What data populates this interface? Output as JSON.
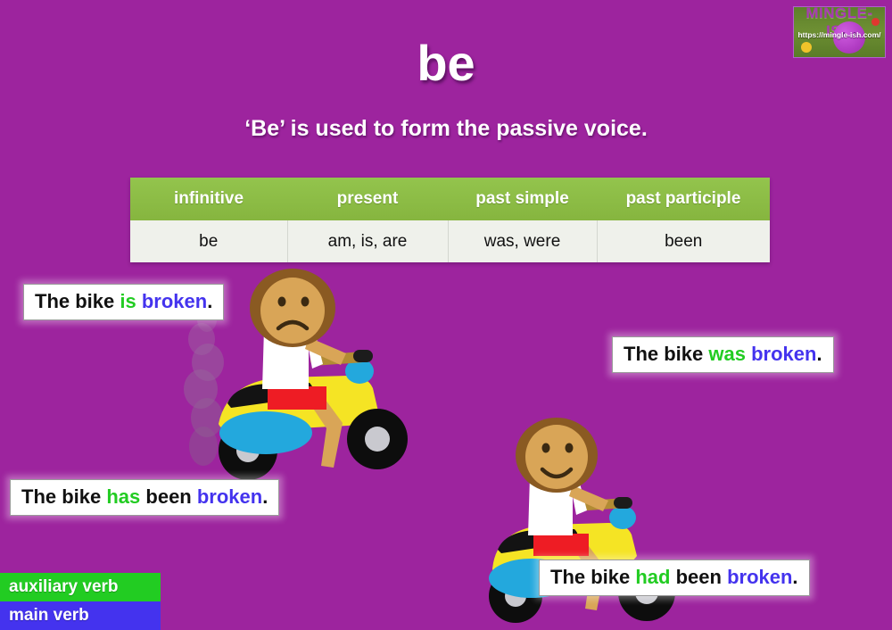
{
  "slide": {
    "title": "be",
    "subtitle": "‘Be’ is used to form the passive voice.",
    "background_color": "#9d249e",
    "background_color_light": "#ad4ec4"
  },
  "watermark": {
    "brand": "MINGLE-ISH",
    "url": "https://mingle-ish.com/",
    "background_color": "#6d8f33",
    "brand_color": "#a838b4"
  },
  "table": {
    "headers": [
      "infinitive",
      "present",
      "past simple",
      "past participle"
    ],
    "row": [
      "be",
      "am, is, are",
      "was, were",
      "been"
    ],
    "header_color": "#8cbc45",
    "row_color": "#eff1eb"
  },
  "captions": [
    {
      "id": "caption-is",
      "parts": [
        {
          "text": "The bike ",
          "role": "plain"
        },
        {
          "text": "is",
          "role": "auxiliary"
        },
        {
          "text": " ",
          "role": "plain"
        },
        {
          "text": "broken",
          "role": "main"
        },
        {
          "text": ".",
          "role": "plain"
        }
      ]
    },
    {
      "id": "caption-was",
      "parts": [
        {
          "text": "The bike ",
          "role": "plain"
        },
        {
          "text": "was",
          "role": "auxiliary"
        },
        {
          "text": " ",
          "role": "plain"
        },
        {
          "text": "broken",
          "role": "main"
        },
        {
          "text": ".",
          "role": "plain"
        }
      ]
    },
    {
      "id": "caption-has-been",
      "parts": [
        {
          "text": "The bike ",
          "role": "plain"
        },
        {
          "text": "has",
          "role": "auxiliary"
        },
        {
          "text": " been ",
          "role": "plain"
        },
        {
          "text": "broken",
          "role": "main"
        },
        {
          "text": ".",
          "role": "plain"
        }
      ]
    },
    {
      "id": "caption-had-been",
      "parts": [
        {
          "text": "The bike ",
          "role": "plain"
        },
        {
          "text": "had",
          "role": "auxiliary"
        },
        {
          "text": " been ",
          "role": "plain"
        },
        {
          "text": "broken",
          "role": "main"
        },
        {
          "text": ".",
          "role": "plain"
        }
      ]
    }
  ],
  "legend": {
    "auxiliary_label": "auxiliary verb",
    "auxiliary_color": "#22cc22",
    "main_label": "main verb",
    "main_color": "#4433ee"
  },
  "illustrations": {
    "broken_scooter": {
      "name": "rider-on-broken-scooter",
      "mood": "sad",
      "has_smoke": true,
      "scooter_body_color": "#f5e424",
      "scooter_panel_color": "#23a8dd",
      "shirt_color": "#ffffff",
      "shorts_color": "#ee1c24",
      "skin_color": "#d9a557",
      "hair_color": "#8a5a22",
      "smoke_color": "#7d7b84"
    },
    "fixed_scooter": {
      "name": "rider-on-fixed-scooter",
      "mood": "happy",
      "has_smoke": false,
      "scooter_body_color": "#f5e424",
      "scooter_panel_color": "#23a8dd",
      "shirt_color": "#ffffff",
      "shorts_color": "#ee1c24",
      "skin_color": "#d9a557",
      "hair_color": "#8a5a22"
    }
  }
}
